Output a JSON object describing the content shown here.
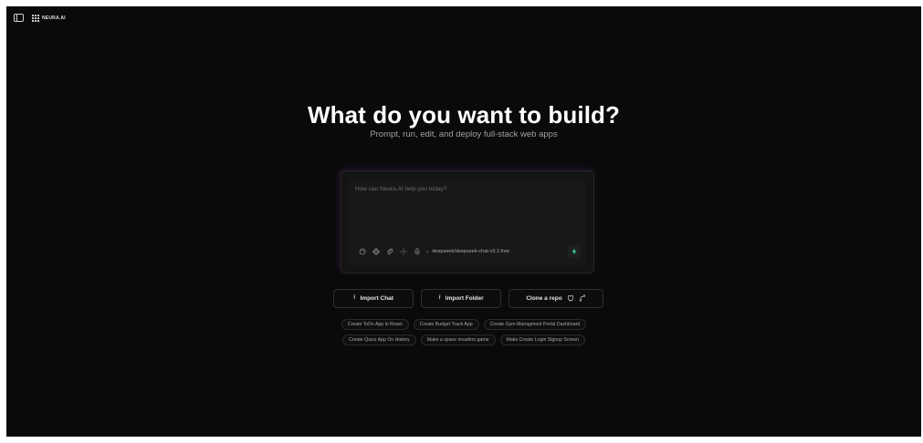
{
  "app": {
    "logo_text": "NEURA.AI"
  },
  "hero": {
    "title": "What do you want to build?",
    "subtitle": "Prompt, run, edit, and deploy full-stack web apps"
  },
  "prompt": {
    "placeholder": "How can Neura.AI help you today?",
    "model_name": "deepseek/deepseek-chat-v3.1:free"
  },
  "actions": {
    "import_chat": "Import Chat",
    "import_folder": "Import Folder",
    "clone_repo": "Clone a repo"
  },
  "suggestions": {
    "row1": [
      "Create ToDo App in React",
      "Create Budget Track App",
      "Create Gym Managment Portal Dashboard"
    ],
    "row2": [
      "Create Quizz App On History",
      "Make a space invaders game",
      "Make Create Login Signup Screen"
    ]
  },
  "colors": {
    "background": "#0a0a0a",
    "accent_send": "#34d399",
    "glow": "#9b3cd2"
  },
  "icons": {
    "sidebar": "sidebar-toggle-icon",
    "logo": "neura-logo-icon",
    "tools": [
      "palette-icon",
      "figma-icon",
      "paperclip-icon",
      "sparkle-icon",
      "microphone-icon"
    ],
    "model": "chevron-right-icon",
    "send": "lightning-icon",
    "import": "upload-icon",
    "repo": [
      "git-icon",
      "branch-icon"
    ]
  }
}
